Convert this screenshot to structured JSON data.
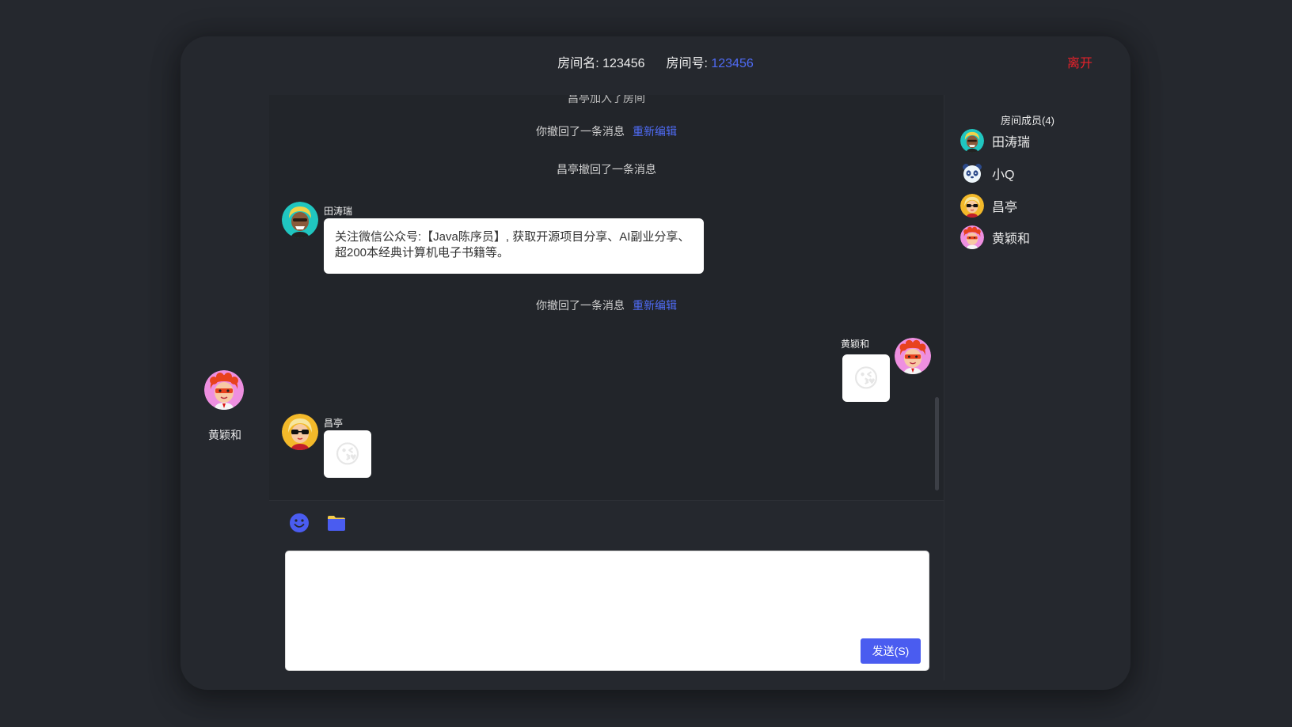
{
  "header": {
    "room_name_label": "房间名:",
    "room_name": "123456",
    "room_id_label": "房间号:",
    "room_id": "123456",
    "leave_label": "离开"
  },
  "me": {
    "name": "黄颖和",
    "avatar_icon": "redhair-avatar-icon"
  },
  "chat": {
    "top_cut_text": "昌亭加入了房间",
    "recall_self_1": "你撤回了一条消息",
    "reedit_1": "重新编辑",
    "recall_other": "昌亭撤回了一条消息",
    "msg1_user": "田涛瑞",
    "msg1_text": "关注微信公众号:【Java陈序员】, 获取开源项目分享、AI副业分享、超200本经典计算机电子书籍等。",
    "recall_self_2": "你撤回了一条消息",
    "reedit_2": "重新编辑",
    "msg2_user": "黄颖和",
    "msg2_emoji": "😘",
    "msg3_user": "昌亭",
    "msg3_emoji": "😘"
  },
  "toolbar": {
    "emoji_icon": "smiley-icon",
    "file_icon": "folder-icon"
  },
  "composer": {
    "value": "",
    "placeholder": "",
    "send_label": "发送(S)"
  },
  "members": {
    "title": "房间成员(4)",
    "list": [
      {
        "name": "田涛瑞",
        "icon": "green-hair-avatar-icon"
      },
      {
        "name": "小Q",
        "icon": "panda-avatar-icon"
      },
      {
        "name": "昌亭",
        "icon": "sunglasses-avatar-icon"
      },
      {
        "name": "黄颖和",
        "icon": "redhair-avatar-icon"
      }
    ]
  },
  "colors": {
    "background": "#25282e",
    "accent": "#4f6bf5",
    "danger": "#e8212a",
    "send": "#4a5cf0"
  }
}
